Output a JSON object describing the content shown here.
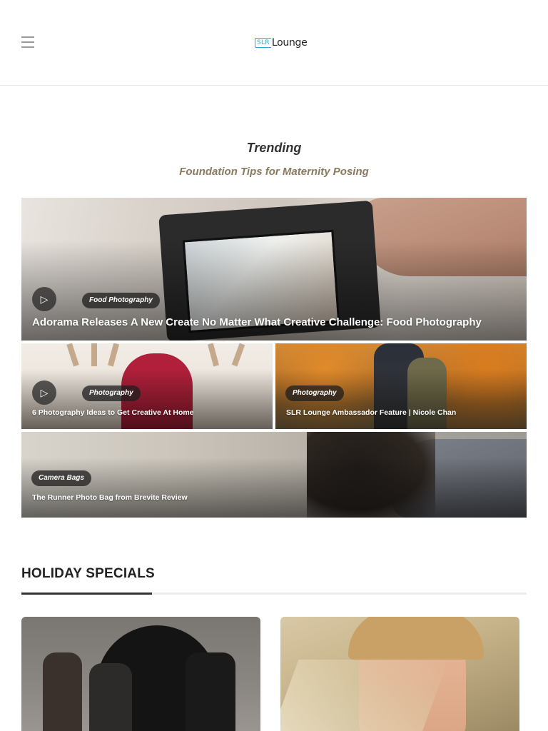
{
  "header": {
    "logo_box": "SLR",
    "logo_word": "Lounge"
  },
  "trending": {
    "title": "Trending",
    "subtitle": "Foundation Tips for Maternity Posing"
  },
  "cards": [
    {
      "category": "Food Photography",
      "title": "Adorama Releases A New Create No Matter What Creative Challenge: Food Photography",
      "has_video": true
    },
    {
      "category": "Photography",
      "title": "6 Photography Ideas to Get Creative At Home",
      "has_video": true
    },
    {
      "category": "Photography",
      "title": "SLR Lounge Ambassador Feature | Nicole Chan",
      "has_video": false
    },
    {
      "category": "Camera Bags",
      "title": "The Runner Photo Bag from Brevite Review",
      "has_video": false
    }
  ],
  "icons": {
    "play": "▷",
    "menu": "hamburger-menu-icon"
  },
  "holiday": {
    "title": "HOLIDAY SPECIALS"
  },
  "colors": {
    "accent_brand": "#2aa7c9",
    "subtitle": "#8a7a5e"
  }
}
